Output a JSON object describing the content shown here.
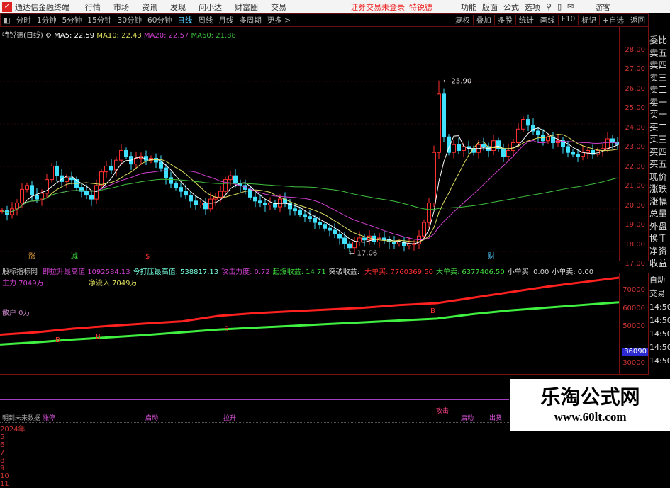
{
  "app": {
    "title": "通达信金融终端",
    "menus": [
      "行情",
      "市场",
      "资讯",
      "发现",
      "问小达",
      "财富圈",
      "交易"
    ],
    "alert": "证券交易未登录",
    "stock_link": "特锐德",
    "right_menus": [
      "功能",
      "版面",
      "公式",
      "选项"
    ],
    "guest": "游客"
  },
  "toolbar": {
    "periods": [
      "分时",
      "1分钟",
      "5分钟",
      "15分钟",
      "30分钟",
      "60分钟",
      "日线",
      "周线",
      "月线",
      "多周期",
      "更多 >"
    ],
    "active": "日线",
    "right": [
      "复权",
      "叠加",
      "多股",
      "统计",
      "画线",
      "F10",
      "标记",
      "+自选",
      "返回"
    ]
  },
  "info": {
    "name": "特锐德(日线)",
    "ma5": "MA5: 22.59",
    "ma10": "MA10: 22.43",
    "ma20": "MA20: 22.57",
    "ma60": "MA60: 21.88"
  },
  "colors": {
    "ma5": "#ffffff",
    "ma10": "#e0e060",
    "ma20": "#d040d0",
    "ma60": "#40c040",
    "up": "#ff3030",
    "down": "#40e0ff"
  },
  "price_axis": [
    "28.00",
    "27.00",
    "26.00",
    "25.00",
    "24.00",
    "23.00",
    "22.00",
    "21.00",
    "20.00",
    "19.00",
    "18.00",
    "17.00"
  ],
  "right_panel": [
    "委比",
    "卖五",
    "卖四",
    "卖三",
    "卖二",
    "卖一",
    "买一",
    "买二",
    "买三",
    "买四",
    "买五",
    "现价",
    "涨跌",
    "涨幅",
    "总量",
    "外盘",
    "换手",
    "净资",
    "收益"
  ],
  "chart_data": {
    "type": "candlestick",
    "ylim": [
      16.8,
      28.2
    ],
    "high_label": "25.90",
    "low_label": "17.06",
    "closes": [
      19.2,
      19.0,
      19.3,
      19.6,
      20.3,
      20.5,
      20.0,
      19.8,
      20.1,
      20.8,
      21.5,
      21.0,
      20.7,
      20.9,
      20.8,
      20.4,
      20.2,
      20.0,
      19.8,
      20.5,
      21.2,
      21.5,
      21.3,
      21.8,
      22.3,
      22.0,
      21.6,
      21.9,
      22.0,
      21.8,
      21.9,
      21.7,
      21.4,
      20.9,
      20.6,
      20.4,
      20.2,
      20.0,
      19.7,
      19.5,
      19.6,
      19.3,
      19.8,
      19.9,
      20.2,
      20.8,
      21.0,
      20.6,
      20.5,
      20.3,
      19.9,
      19.7,
      19.6,
      19.5,
      19.6,
      19.4,
      19.8,
      19.6,
      19.3,
      19.2,
      19.0,
      18.9,
      18.8,
      18.6,
      18.5,
      18.3,
      18.2,
      18.0,
      17.8,
      17.5,
      17.3,
      17.6,
      17.8,
      17.7,
      17.9,
      17.6,
      17.8,
      17.7,
      17.6,
      17.5,
      17.6,
      17.4,
      17.5,
      17.5,
      17.9,
      18.6,
      19.6,
      22.2,
      25.2,
      23.0,
      22.2,
      22.6,
      22.3,
      22.5,
      22.4,
      22.2,
      22.6,
      22.5,
      22.3,
      22.8,
      22.4,
      22.0,
      22.3,
      22.7,
      23.4,
      23.9,
      23.6,
      23.3,
      23.1,
      22.8,
      23.0,
      22.7,
      22.8,
      22.5,
      22.2,
      22.1,
      22.0,
      22.2,
      22.3,
      22.1,
      22.3,
      22.4,
      22.9,
      22.7,
      22.6
    ]
  },
  "markers": [
    "涨",
    "减",
    "$",
    "财"
  ],
  "indicator": {
    "title": "股标指标网",
    "items": [
      {
        "k": "即拉升最高值",
        "v": "1092584.13",
        "c": "#d040d0"
      },
      {
        "k": "今打压最高值:",
        "v": "538817.13",
        "c": "#7fd"
      },
      {
        "k": "攻击力度:",
        "v": "0.72",
        "c": "#d040d0"
      },
      {
        "k": "起爆收益:",
        "v": "14.71",
        "c": "#40e040"
      },
      {
        "k": "突破收益:",
        "v": "",
        "c": "#ddd"
      },
      {
        "k": "大单买:",
        "v": "7760369.50",
        "c": "#ff3030"
      },
      {
        "k": "大单卖:",
        "v": "6377406.50",
        "c": "#40e040"
      },
      {
        "k": "小单买:",
        "v": "0.00",
        "c": "#ddd"
      },
      {
        "k": "小单卖:",
        "v": "0.00",
        "c": "#ddd"
      }
    ],
    "main_force": "主力 7049万",
    "net_inflow": "净流入 7049万",
    "retail": "散户 0万",
    "axis": [
      "70000",
      "60000",
      "50000",
      "40000",
      "30000"
    ],
    "current": "36090",
    "red": [
      45700,
      47000,
      49000,
      50500,
      51800,
      53000,
      56000,
      57500,
      58500,
      59500,
      60500,
      62000,
      63000,
      66000,
      69000,
      72000,
      74500,
      77000
    ],
    "green": [
      40300,
      41500,
      43000,
      44200,
      45500,
      47000,
      48500,
      49500,
      50500,
      51500,
      52500,
      53500,
      54500,
      57000,
      59000,
      60500,
      62000,
      63500
    ]
  },
  "times": [
    "自动",
    "交易",
    "14:50",
    "14:50",
    "14:50",
    "14:50",
    "14:50"
  ],
  "bottom": {
    "label": "明到未来数据",
    "signals": [
      "涨停",
      "启动",
      "拉升",
      "攻击",
      "启动",
      "出货"
    ],
    "dates": [
      "2024年",
      "5",
      "6",
      "7",
      "8",
      "9",
      "10",
      "11"
    ]
  },
  "watermark": {
    "title": "乐淘公式网",
    "url": "www.60lt.com"
  }
}
